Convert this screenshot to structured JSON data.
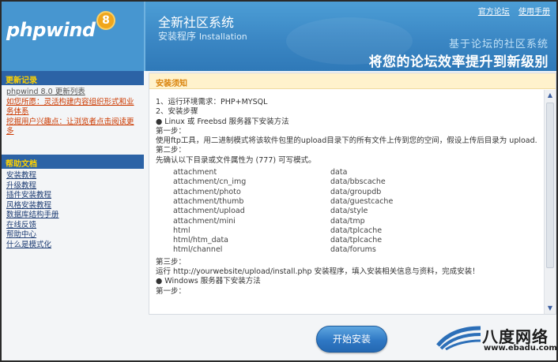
{
  "header": {
    "logo_text": "phpwind",
    "logo_badge": "8",
    "title": "全新社区系统",
    "subtitle_cn": "安装程序",
    "subtitle_en": "Installation",
    "links": [
      "官方论坛",
      "使用手册"
    ],
    "slogan_line1": "基于论坛的社区系统",
    "slogan_line2": "将您的论坛效率提升到新级别"
  },
  "sidebar": {
    "updates_title": "更新记录",
    "updates": [
      "phpwind 8.0 更新列表",
      "如您所愿：灵活构建内容组织形式和业务体系",
      "挖掘用户兴趣点：让浏览者点击阅读更多"
    ],
    "help_title": "帮助文档",
    "help_items": [
      "安装教程",
      "升级教程",
      "插件安装教程",
      "风格安装教程",
      "数据库结构手册",
      "在线反馈",
      "帮助中心",
      "什么是模式化"
    ]
  },
  "main": {
    "title": "安装须知",
    "lines": [
      "1、运行环境需求：PHP+MYSQL",
      "2、安装步骤",
      "● Linux 或 Freebsd 服务器下安装方法",
      "第一步：",
      "使用ftp工具，用二进制模式将该软件包里的upload目录下的所有文件上传到您的空间，假设上传后目录为 upload.",
      "第二步：",
      "先确认以下目录或文件属性为 (777) 可写模式。"
    ],
    "files": [
      [
        "attachment",
        "data"
      ],
      [
        "attachment/cn_img",
        "data/bbscache"
      ],
      [
        "attachment/photo",
        "data/groupdb"
      ],
      [
        "attachment/thumb",
        "data/guestcache"
      ],
      [
        "attachment/upload",
        "data/style"
      ],
      [
        "attachment/mini",
        "data/tmp"
      ],
      [
        "html",
        "data/tplcache"
      ],
      [
        "html/htm_data",
        "data/tplcache"
      ],
      [
        "html/channel",
        "data/forums"
      ]
    ],
    "lines_after": [
      "第三步：",
      "运行 http://yourwebsite/upload/install.php 安装程序，填入安装相关信息与资料，完成安装！",
      "● Windows 服务器下安装方法",
      "第一步："
    ]
  },
  "footer": {
    "start_button": "开始安装",
    "brand_name": "八度网络",
    "brand_url": "www.ebadu.com"
  }
}
